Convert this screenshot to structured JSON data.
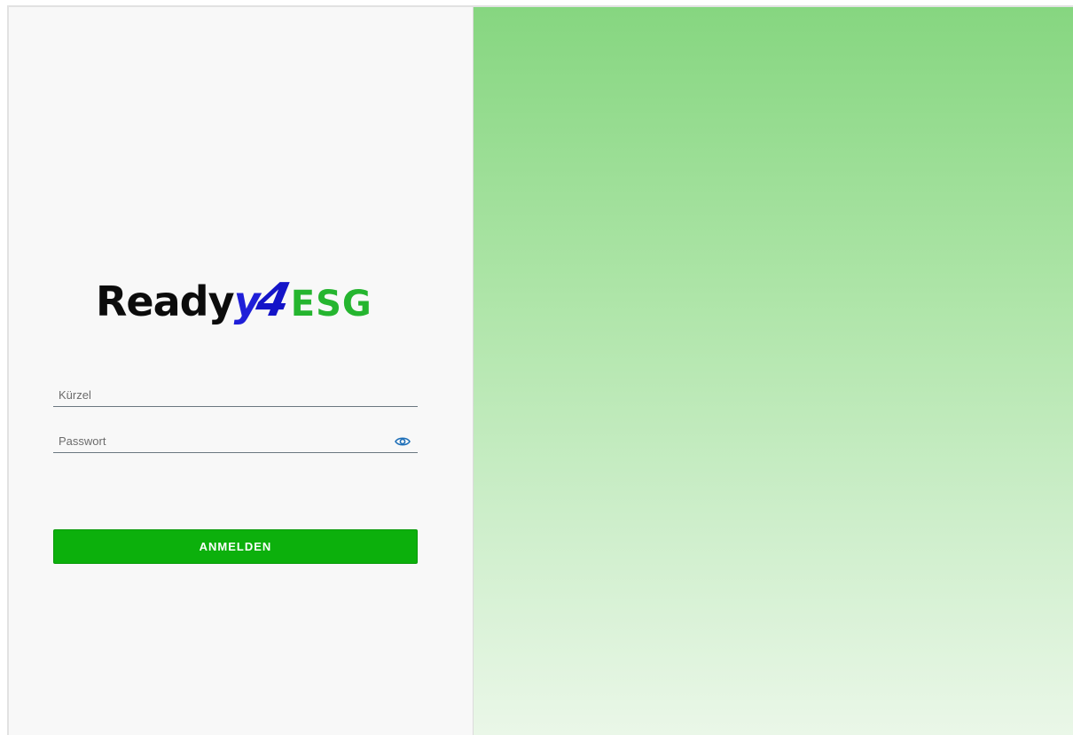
{
  "logo": {
    "part_ready": "Ready",
    "part_y": "y",
    "part_4": "4",
    "part_esg": "ESG",
    "colors": {
      "ready": "#0c0c0c",
      "four": "#1414c8",
      "esg": "#25b52f"
    }
  },
  "form": {
    "username": {
      "placeholder": "Kürzel",
      "value": ""
    },
    "password": {
      "placeholder": "Passwort",
      "value": "",
      "toggle_icon": "eye-icon"
    },
    "submit_label": "ANMELDEN"
  },
  "colors": {
    "button": "#0cb00c",
    "panel_background": "#f8f8f8",
    "hero_gradient_top": "#86d680",
    "hero_gradient_bottom": "#eaf7e8",
    "eye_icon": "#1e6fb8"
  }
}
